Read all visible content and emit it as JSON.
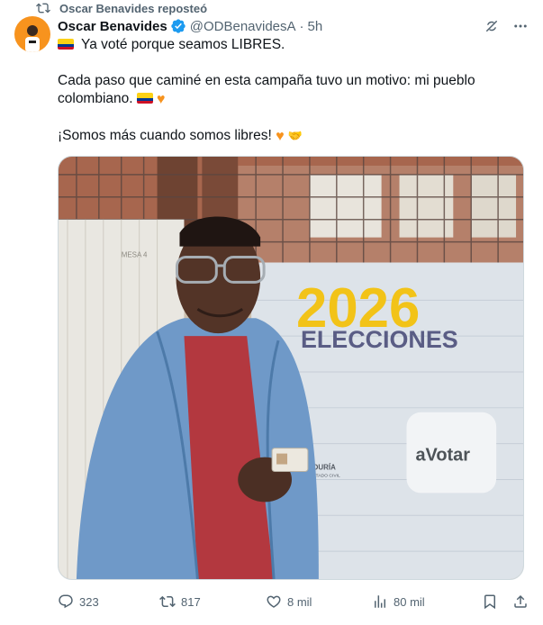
{
  "repost": {
    "label": "Oscar Benavides reposteó"
  },
  "author": {
    "name": "Oscar Benavides",
    "handle": "@ODBenavidesA",
    "separator": "·",
    "time": "5h"
  },
  "tweet": {
    "line1": "Ya voté porque seamos LIBRES.",
    "line2": "Cada paso que caminé en esta campaña tuvo un motivo: mi pueblo colombiano.",
    "line3": "¡Somos más cuando somos libres!"
  },
  "media": {
    "sign_year": "2026",
    "sign_title": "ELECCIONES",
    "sign_button": "aVotar",
    "sign_org": "ADURÍA",
    "sign_org2": "ESTADO CIVIL",
    "table_label": "MESA 4"
  },
  "metrics": {
    "replies": "323",
    "reposts": "817",
    "likes": "8 mil",
    "views": "80 mil"
  },
  "colors": {
    "accent": "#1d9bf0",
    "secondary_text": "#536471",
    "heart": "#f7931e"
  }
}
